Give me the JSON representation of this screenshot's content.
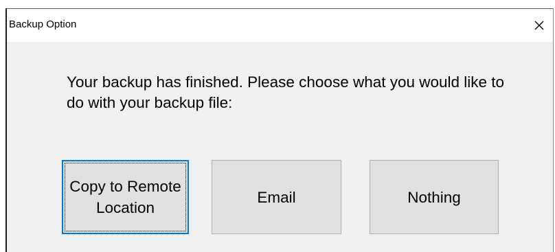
{
  "window": {
    "title": "Backup Option",
    "close_icon": "close-icon"
  },
  "message": {
    "text": "Your backup has finished. Please choose what you would like to do with your backup file:"
  },
  "buttons": {
    "copy_label": "Copy to Remote Location",
    "email_label": "Email",
    "nothing_label": "Nothing"
  },
  "colors": {
    "focus_border": "#0078d7",
    "button_face": "#e1e1e1",
    "dialog_background": "#f0f0f0"
  }
}
